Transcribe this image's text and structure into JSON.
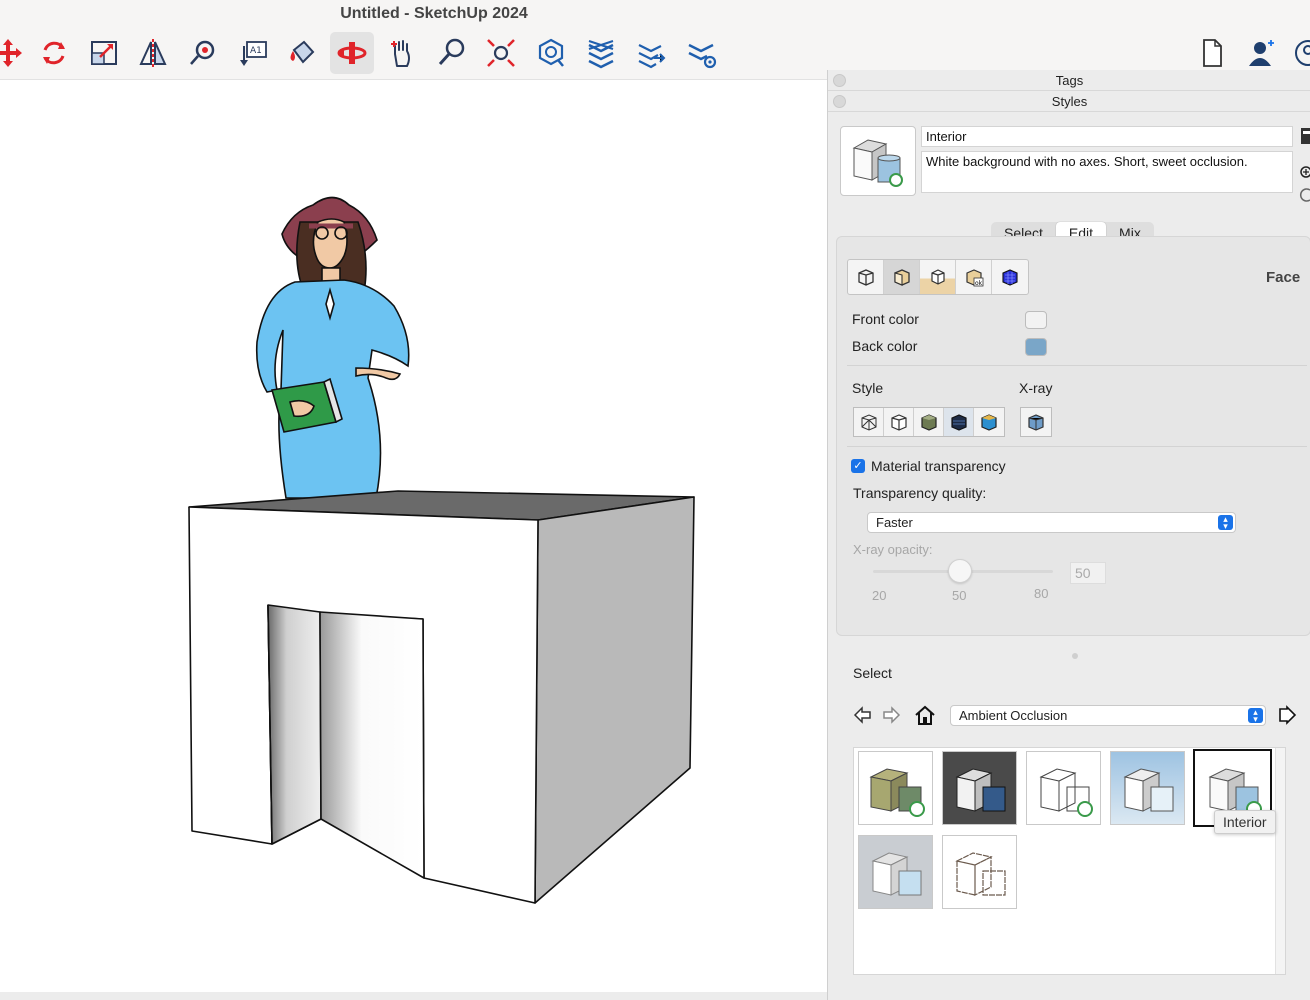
{
  "window": {
    "title": "Untitled - SketchUp 2024"
  },
  "toolbar": {
    "tools": [
      {
        "name": "move-icon"
      },
      {
        "name": "rotate-icon"
      },
      {
        "name": "scale-icon"
      },
      {
        "name": "flip-icon"
      },
      {
        "name": "tape-measure-icon"
      },
      {
        "name": "text-label-icon"
      },
      {
        "name": "paint-bucket-icon"
      },
      {
        "name": "orbit-icon",
        "active": true
      },
      {
        "name": "pan-icon"
      },
      {
        "name": "zoom-icon"
      },
      {
        "name": "zoom-extents-icon"
      },
      {
        "name": "section-plane-icon"
      },
      {
        "name": "layers-icon"
      },
      {
        "name": "layers-export-icon"
      },
      {
        "name": "layers-settings-icon"
      }
    ],
    "right": [
      {
        "name": "document-icon"
      },
      {
        "name": "user-icon"
      },
      {
        "name": "profile-icon"
      }
    ]
  },
  "panel": {
    "tray_items": [
      "Tags",
      "Styles"
    ],
    "style_name": "Interior",
    "style_description": "White background with no axes. Short, sweet occlusion.",
    "tabs": [
      {
        "label": "Select",
        "active": false
      },
      {
        "label": "Edit",
        "active": true
      },
      {
        "label": "Mix",
        "active": false
      }
    ],
    "section_label": "Face",
    "front_color_label": "Front color",
    "back_color_label": "Back color",
    "front_color": "#f2f2f2",
    "back_color": "#7aa6c8",
    "style_label": "Style",
    "xray_label": "X-ray",
    "material_transparency_label": "Material transparency",
    "material_transparency_checked": true,
    "transparency_quality_label": "Transparency quality:",
    "transparency_quality_value": "Faster",
    "xray_opacity_label": "X-ray opacity:",
    "xray_opacity_value": "50",
    "slider_ticks": [
      "20",
      "50",
      "80"
    ],
    "select_label": "Select",
    "collection_value": "Ambient Occlusion",
    "tooltip": "Interior"
  }
}
